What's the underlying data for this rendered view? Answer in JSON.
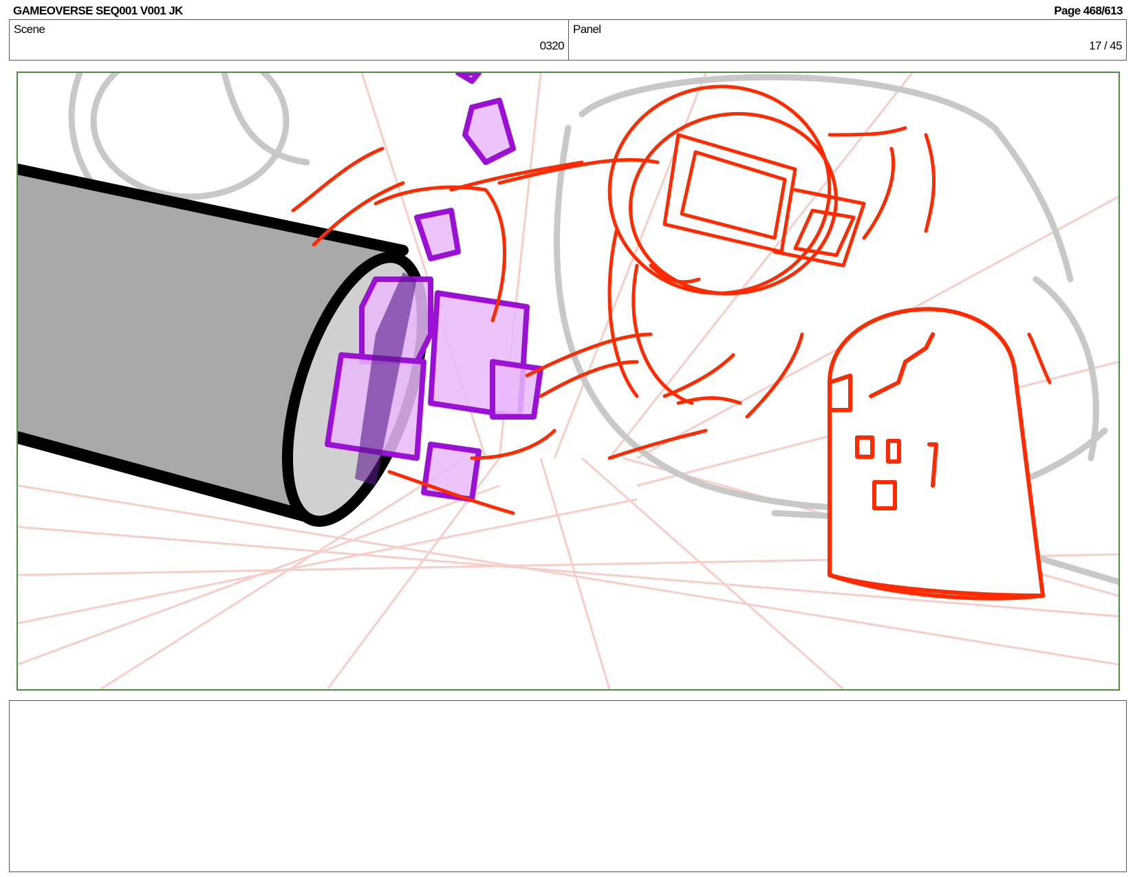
{
  "header": {
    "title": "GAMEOVERSE SEQ001 V001 JK",
    "page": "Page 468/613"
  },
  "scene": {
    "label": "Scene",
    "value": "0320"
  },
  "panel": {
    "label": "Panel",
    "value": "17 / 45"
  },
  "colors": {
    "frame_border": "#4a8f3c",
    "sketch_red": "#ff2a00",
    "grid_pink": "#f7c9c2",
    "rough_gray": "#c8c8c8",
    "cube_purple": "#9a10d4",
    "cube_fill": "#eab8fb",
    "pipe_gray": "#a9a9a9"
  },
  "notes": {
    "text": ""
  }
}
